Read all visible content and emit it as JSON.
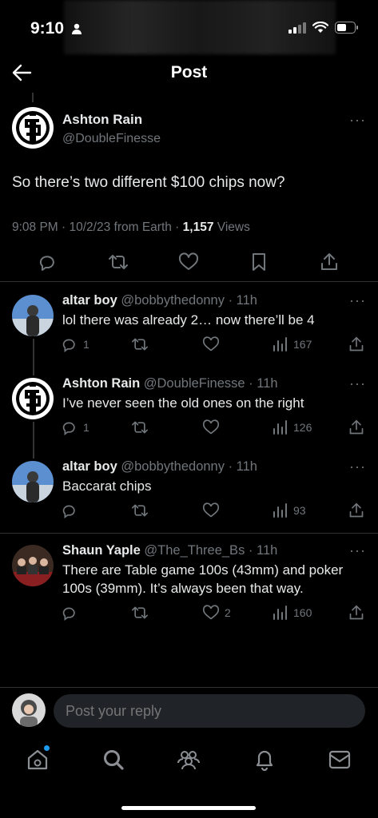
{
  "status_bar": {
    "time": "9:10"
  },
  "header": {
    "title": "Post"
  },
  "post": {
    "author_name": "Ashton Rain",
    "author_handle": "@DoubleFinesse",
    "text": "So there’s two different $100 chips now?",
    "meta_time": "9:08 PM · 10/2/23 from Earth · ",
    "views_count": "1,157",
    "views_label": " Views"
  },
  "replies": [
    {
      "name": "altar boy",
      "handle": "@bobbythedonny",
      "time": "· 11h",
      "text": "lol there was already 2… now there’ll be 4",
      "reply_count": "1",
      "like_count": "",
      "view_count": "167"
    },
    {
      "name": "Ashton Rain",
      "handle": "@DoubleFinesse",
      "time": "· 11h",
      "text": "I’ve never seen the old ones on the right",
      "reply_count": "1",
      "like_count": "",
      "view_count": "126"
    },
    {
      "name": "altar boy",
      "handle": "@bobbythedonny",
      "time": "· 11h",
      "text": "Baccarat chips",
      "reply_count": "",
      "like_count": "",
      "view_count": "93"
    },
    {
      "name": "Shaun Yaple",
      "handle": "@The_Three_Bs",
      "time": "· 11h",
      "text": "There are Table game 100s (43mm) and poker 100s (39mm). It’s always been that way.",
      "reply_count": "",
      "like_count": "2",
      "view_count": "160"
    }
  ],
  "composer": {
    "placeholder": "Post your reply"
  },
  "colors": {
    "background": "#000000",
    "text": "#e7e9ea",
    "muted": "#71767b",
    "divider": "#2f3336",
    "accent": "#1d9bf0"
  },
  "icons": [
    "back-arrow",
    "reply",
    "retweet",
    "like",
    "bookmark",
    "share",
    "views",
    "home",
    "search",
    "communities",
    "notifications",
    "messages"
  ]
}
